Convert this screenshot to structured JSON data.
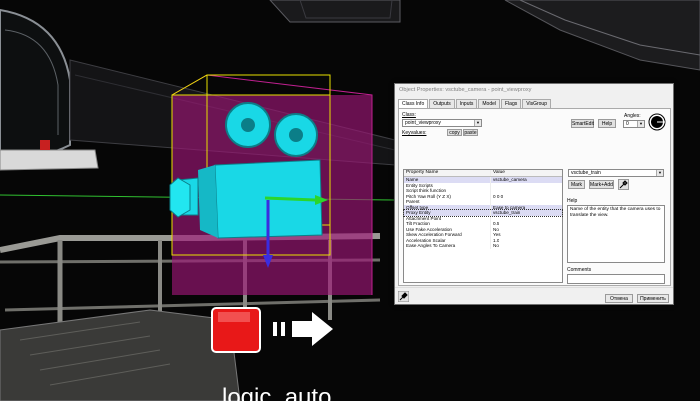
{
  "viewport": {
    "entity_label": "logic_auto",
    "colors": {
      "camera": "#19d8e6",
      "bbox": "#9c1577",
      "selection": "#e8e000",
      "axis_x": "#2bd62b",
      "axis_y": "#3a2ce0",
      "logic_icon": "#e81818"
    }
  },
  "dialog": {
    "title": "Object Properties: vsctube_camera - point_viewproxy",
    "tabs": [
      {
        "label": "Class Info"
      },
      {
        "label": "Outputs"
      },
      {
        "label": "Inputs"
      },
      {
        "label": "Model"
      },
      {
        "label": "Flags"
      },
      {
        "label": "VisGroup"
      }
    ],
    "class_label": "Class:",
    "class_value": "point_viewproxy",
    "keyvalues_label": "Keyvalues:",
    "copy_label": "copy",
    "paste_label": "paste",
    "smartedit_label": "SmartEdit",
    "help_button_label": "Help",
    "angles_label": "Angles:",
    "angles_value": "0",
    "table": {
      "col_property": "Property Name",
      "col_value": "Value",
      "rows": [
        {
          "name": "Name",
          "value": "vsctube_camera"
        },
        {
          "name": "Entity Scripts",
          "value": ""
        },
        {
          "name": "Script think function",
          "value": ""
        },
        {
          "name": "Pitch Yaw Roll (Y Z X)",
          "value": "0 0 0"
        },
        {
          "name": "Parent",
          "value": ""
        },
        {
          "name": "Offset type",
          "value": "Ease to camera"
        },
        {
          "name": "Proxy Entity",
          "value": "vsctube_train"
        },
        {
          "name": "Attachment Point",
          "value": ""
        },
        {
          "name": "Tilt Fraction",
          "value": "0.5"
        },
        {
          "name": "Use Fake Acceleration",
          "value": "No"
        },
        {
          "name": "Skew Acceleration Forward",
          "value": "Yes"
        },
        {
          "name": "Acceleration Scalar",
          "value": "1.0"
        },
        {
          "name": "Ease Angles To Camera",
          "value": "No"
        }
      ]
    },
    "value_combo": "vsctube_train",
    "mark_label": "Mark",
    "markadd_label": "Mark+Add",
    "help_label": "Help",
    "help_text": "Name of the entity that the camera uses to translate the view.",
    "comments_label": "Comments",
    "cancel_label": "Отмена",
    "apply_label": "Применить"
  }
}
